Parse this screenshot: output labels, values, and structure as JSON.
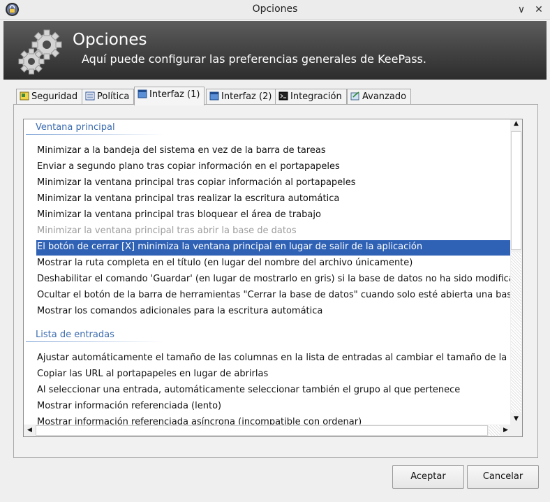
{
  "window": {
    "title": "Opciones",
    "icon": "lock-icon",
    "minimize_glyph": "∨",
    "close_glyph": "✕"
  },
  "banner": {
    "title": "Opciones",
    "subtitle": "Aquí puede configurar las preferencias generales de KeePass.",
    "icon": "gears-icon"
  },
  "tabs": [
    {
      "label": "Seguridad",
      "icon": "shield-icon",
      "active": false
    },
    {
      "label": "Política",
      "icon": "list-icon",
      "active": false
    },
    {
      "label": "Interfaz (1)",
      "icon": "window-icon",
      "active": true
    },
    {
      "label": "Interfaz (2)",
      "icon": "window-icon",
      "active": false
    },
    {
      "label": "Integración",
      "icon": "terminal-icon",
      "active": false
    },
    {
      "label": "Avanzado",
      "icon": "advanced-icon",
      "active": false
    }
  ],
  "groups": {
    "main_window": {
      "header": "Ventana principal",
      "items": [
        {
          "label": "Minimizar a la bandeja del sistema en vez de la barra de tareas",
          "checked": true
        },
        {
          "label": "Enviar a segundo plano tras copiar información en el portapapeles",
          "checked": false
        },
        {
          "label": "Minimizar la ventana principal tras copiar información al portapapeles",
          "checked": false
        },
        {
          "label": "Minimizar la ventana principal tras realizar la escritura automática",
          "checked": false
        },
        {
          "label": "Minimizar la ventana principal tras bloquear el área de trabajo",
          "checked": true
        },
        {
          "label": "Minimizar la ventana principal tras abrir la base de datos",
          "checked": false,
          "disabled": true
        },
        {
          "label": "El botón de cerrar [X] minimiza la ventana principal en lugar de salir de la aplicación",
          "checked": true,
          "selected": true
        },
        {
          "label": "Mostrar la ruta completa en el título (en lugar del nombre del archivo únicamente)",
          "checked": false
        },
        {
          "label": "Deshabilitar el comando 'Guardar' (en lugar de mostrarlo en gris) si la base de datos no ha sido modificada",
          "checked": false
        },
        {
          "label": "Ocultar el botón de la barra de herramientas \"Cerrar la base de datos\" cuando solo esté abierta una base de...",
          "checked": true
        },
        {
          "label": "Mostrar los comandos adicionales para la escritura automática",
          "checked": false
        }
      ]
    },
    "entry_list": {
      "header": "Lista de entradas",
      "items": [
        {
          "label": "Ajustar automáticamente el tamaño de las columnas en la lista de entradas al cambiar el tamaño de la venta...",
          "checked": false
        },
        {
          "label": "Copiar las URL al portapapeles en lugar de abrirlas",
          "checked": false
        },
        {
          "label": "Al seleccionar una entrada, automáticamente seleccionar también el grupo al que pertenece",
          "checked": true
        },
        {
          "label": "Mostrar información referenciada (lento)",
          "checked": false
        },
        {
          "label": "Mostrar información referenciada asíncrona (incompatible con ordenar)",
          "checked": false
        }
      ]
    }
  },
  "buttons": {
    "ok": "Aceptar",
    "cancel": "Cancelar"
  },
  "colors": {
    "selection": "#2f61b5",
    "group_header": "#3c6cb0",
    "banner_dark": "#2d2d2d"
  }
}
